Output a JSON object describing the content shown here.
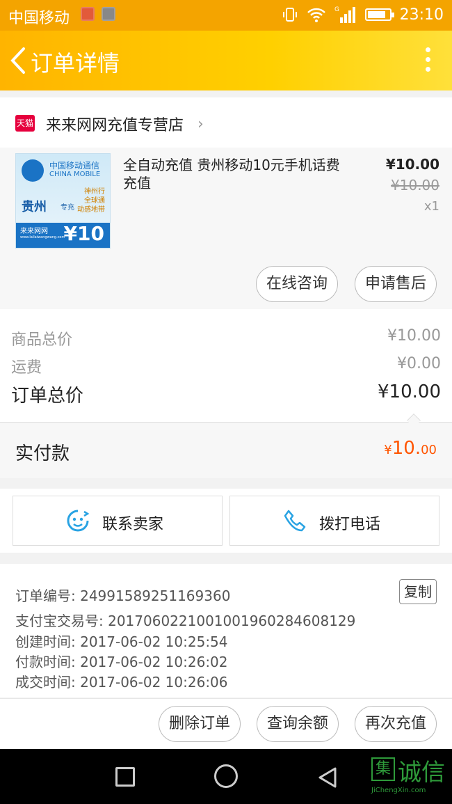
{
  "status_bar": {
    "carrier": "中国移动",
    "network": "G",
    "time": "23:10",
    "battery_level": 0.85
  },
  "header": {
    "title": "订单详情"
  },
  "shop": {
    "badge": "天猫",
    "name": "来来网网充值专营店"
  },
  "product": {
    "thumb": {
      "brand_cn": "中国移动通信",
      "brand_en": "CHINA MOBILE",
      "province": "贵州",
      "province_sub": "专充",
      "slogan": [
        "神州行",
        "全球通",
        "动感地带"
      ],
      "site": "来来网网",
      "site_url": "www.lailaiwangwang.com",
      "face_value": "¥10"
    },
    "title": "全自动充值 贵州移动10元手机话费充值",
    "price": "¥10.00",
    "original_price": "¥10.00",
    "quantity": "x1",
    "consult_label": "在线咨询",
    "aftersale_label": "申请售后"
  },
  "summary": {
    "goods_total_label": "商品总价",
    "goods_total_value": "¥10.00",
    "shipping_label": "运费",
    "shipping_value": "¥0.00",
    "order_total_label": "订单总价",
    "order_total_value": "¥10.00",
    "paid_label": "实付款",
    "paid_currency": "¥",
    "paid_int": "10.",
    "paid_dec": "00"
  },
  "actions": {
    "contact_seller": "联系卖家",
    "call_phone": "拨打电话"
  },
  "order_info": {
    "order_no": "订单编号: 24991589251169360",
    "alipay_no": "支付宝交易号: 2017060221001001960284608129",
    "created": "创建时间: 2017-06-02 10:25:54",
    "paid_time": "付款时间: 2017-06-02 10:26:02",
    "done_time": "成交时间: 2017-06-02 10:26:06",
    "copy_label": "复制"
  },
  "bottom_actions": {
    "delete_order": "删除订单",
    "query_balance": "查询余额",
    "recharge_again": "再次充值"
  },
  "watermark": {
    "box": "集",
    "text": "诚信",
    "sub": "JiChengXin.com"
  },
  "colors": {
    "header_start": "#ffb400",
    "header_end": "#ffe03a",
    "accent_price": "#ff5500",
    "tmall_red": "#e6003d"
  }
}
